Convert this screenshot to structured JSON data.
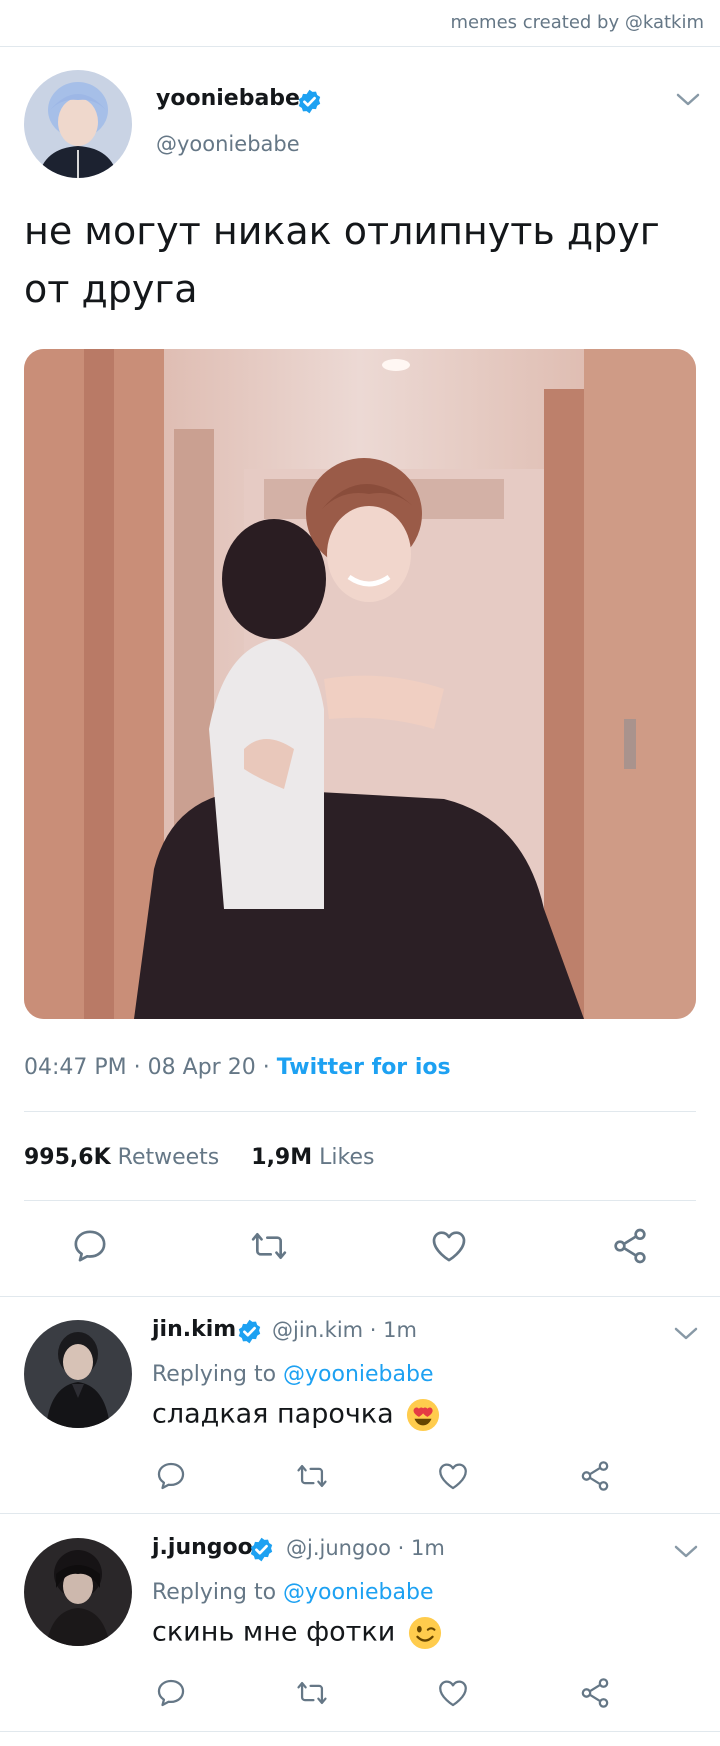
{
  "credit": "memes created by @katkim",
  "tweet": {
    "display_name": "yooniebabe",
    "handle": "@yooniebabe",
    "text": "не могут никак отлипнуть друг от друга",
    "time": "04:47 PM",
    "date": "08 Apr 20",
    "source": "Twitter for ios",
    "retweets_count": "995,6K",
    "retweets_label": "Retweets",
    "likes_count": "1,9M",
    "likes_label": "Likes"
  },
  "replies": [
    {
      "display_name": "jin.kim",
      "handle": "@jin.kim",
      "age": "1m",
      "replying_prefix": "Replying to",
      "replying_to": "@yooniebabe",
      "text": "сладкая парочка",
      "emoji": "heart-eyes-emoji"
    },
    {
      "display_name": "j.jungoo",
      "handle": "@j.jungoo",
      "age": "1m",
      "replying_prefix": "Replying to",
      "replying_to": "@yooniebabe",
      "text": "скинь мне фотки",
      "emoji": "wink-emoji"
    }
  ],
  "colors": {
    "accent": "#1da1f2",
    "secondary_text": "#657786",
    "divider": "#e1e8ed",
    "icon": "#657786"
  }
}
